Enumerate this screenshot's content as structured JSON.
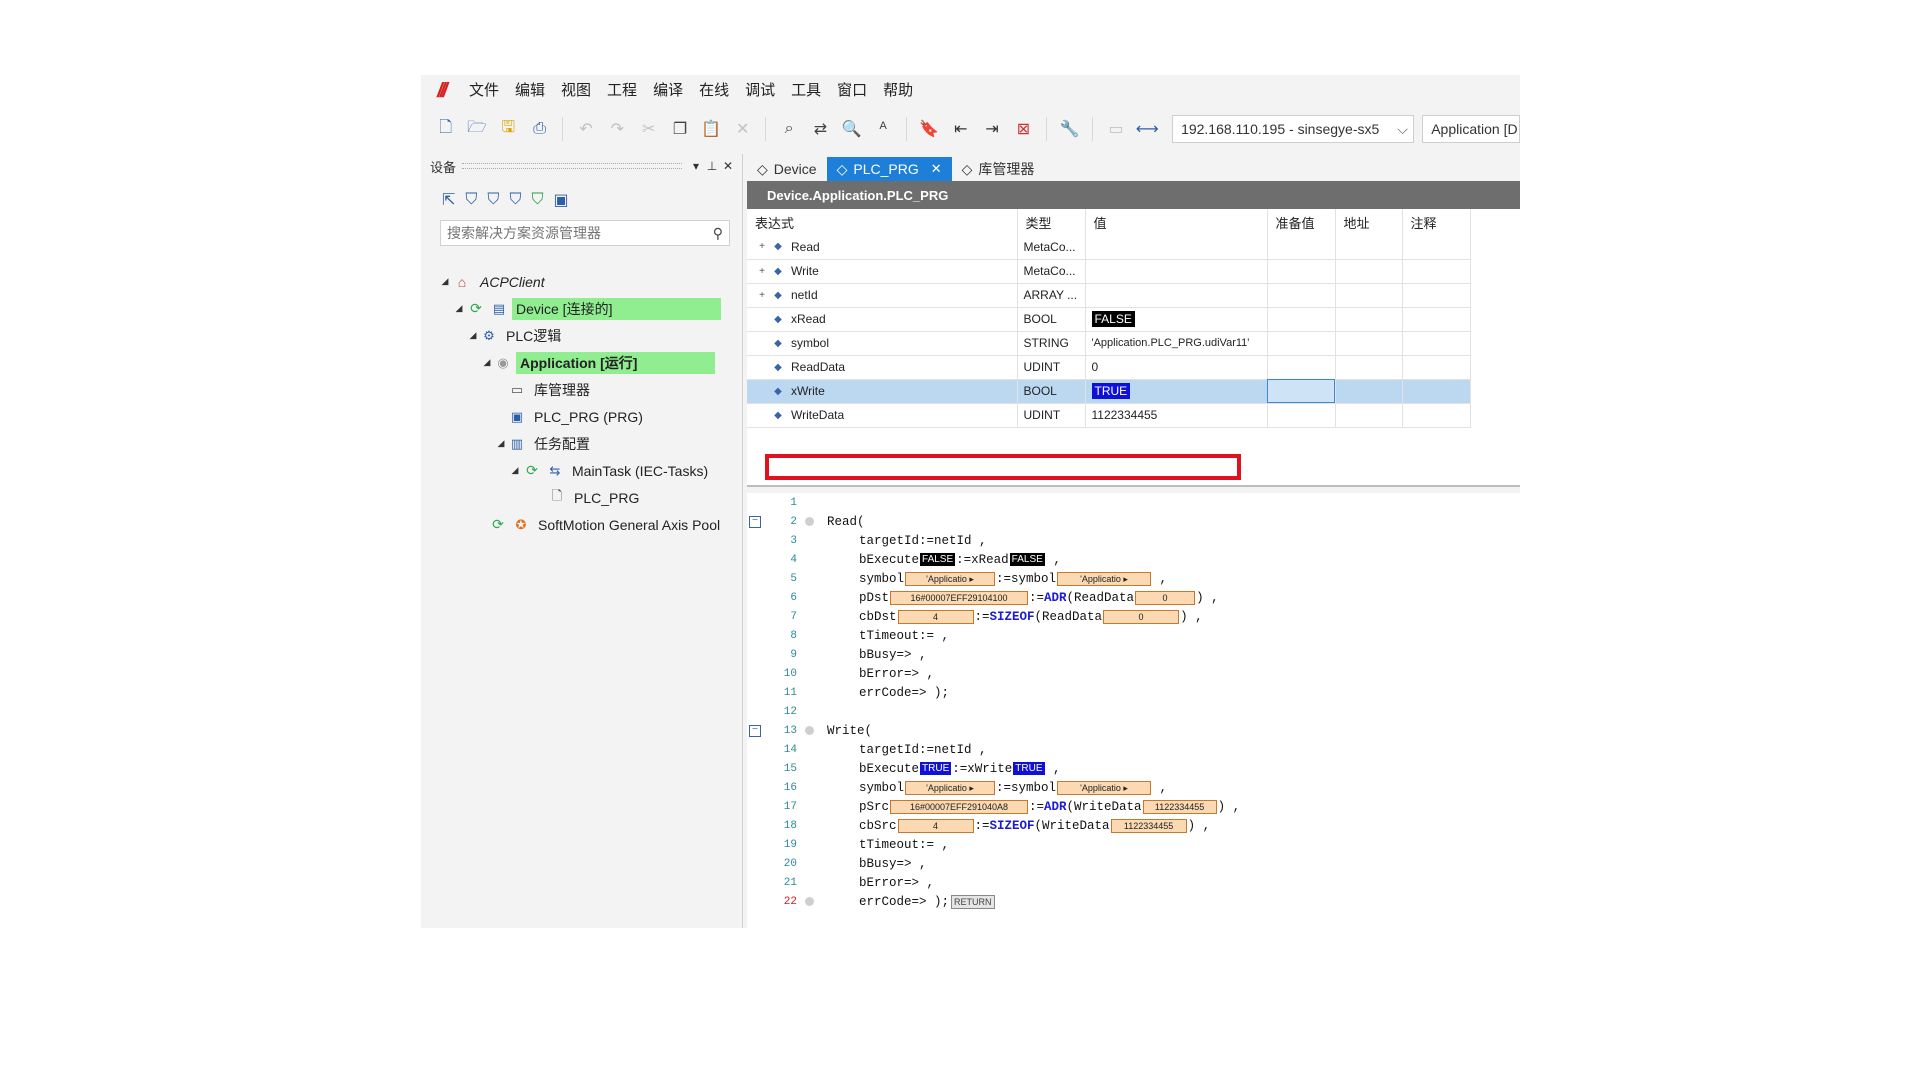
{
  "menu": {
    "logo": "///",
    "items": [
      "文件",
      "编辑",
      "视图",
      "工程",
      "编译",
      "在线",
      "调试",
      "工具",
      "窗口",
      "帮助"
    ]
  },
  "toolbar": {
    "device_combo": "192.168.110.195 - sinsegye-sx5",
    "app_combo": "Application [D",
    "combo_arrow": "⌵"
  },
  "left_panel": {
    "title": "设备",
    "search_placeholder": "搜索解决方案资源管理器",
    "tree": [
      {
        "label": "ACPClient",
        "expand": "◢"
      },
      {
        "label": "Device [连接的]",
        "expand": "◢"
      },
      {
        "label": "PLC逻辑",
        "expand": "◢"
      },
      {
        "label": "Application [运行]",
        "expand": "◢"
      },
      {
        "label": "库管理器"
      },
      {
        "label": "PLC_PRG (PRG)"
      },
      {
        "label": "任务配置",
        "expand": "◢"
      },
      {
        "label": "MainTask (IEC-Tasks)",
        "expand": "◢"
      },
      {
        "label": "PLC_PRG"
      },
      {
        "label": "SoftMotion General Axis Pool"
      }
    ]
  },
  "tabs": [
    {
      "label": "Device"
    },
    {
      "label": "PLC_PRG",
      "close": "✕"
    },
    {
      "label": "库管理器"
    }
  ],
  "doc_title": "Device.Application.PLC_PRG",
  "watch": {
    "columns": [
      "表达式",
      "类型",
      "值",
      "准备值",
      "地址",
      "注释"
    ],
    "rows": [
      {
        "expr": "Read",
        "type": "MetaCo...",
        "value": "",
        "expandable": "+"
      },
      {
        "expr": "Write",
        "type": "MetaCo...",
        "value": "",
        "expandable": "+"
      },
      {
        "expr": "netId",
        "type": "ARRAY ...",
        "value": "",
        "expandable": "+"
      },
      {
        "expr": "xRead",
        "type": "BOOL",
        "value": "FALSE"
      },
      {
        "expr": "symbol",
        "type": "STRING",
        "value": "'Application.PLC_PRG.udiVar11'"
      },
      {
        "expr": "ReadData",
        "type": "UDINT",
        "value": "0"
      },
      {
        "expr": "xWrite",
        "type": "BOOL",
        "value": "TRUE"
      },
      {
        "expr": "WriteData",
        "type": "UDINT",
        "value": "1122334455"
      }
    ]
  },
  "code": {
    "line_numbers": [
      "1",
      "2",
      "3",
      "4",
      "5",
      "6",
      "7",
      "8",
      "9",
      "10",
      "11",
      "12",
      "13",
      "14",
      "15",
      "16",
      "17",
      "18",
      "19",
      "20",
      "21",
      "22"
    ],
    "read_call": "Read(",
    "write_call": "Write(",
    "target": "targetId:=netId ,",
    "bexecute": "bExecute",
    "xread_assign": ":=xRead",
    "xwrite_assign": ":=xWrite",
    "symbol": "symbol",
    "symbol_assign": ":=symbol",
    "pdst": "pDst",
    "psrc": "pSrc",
    "adr_read_open": "(ReadData",
    "adr_write_open": "(WriteData",
    "cbdst": "cbDst",
    "cbsrc": "cbSrc",
    "sizeof_read_open": "(ReadData",
    "sizeof_write_open": "(WriteData",
    "assign": ":=",
    "adr": "ADR",
    "sizeof": "SIZEOF",
    "close_comma": ") ,",
    "comma": " ,",
    "ttimeout": "tTimeout:= ,",
    "bbusy": "bBusy=> ,",
    "berror": "bError=> ,",
    "errcode_end": "errCode=> );",
    "inline": {
      "false": "FALSE",
      "true": "TRUE",
      "applicatio": "'Applicatio",
      "tri": "▸",
      "pdst_val": "16#00007EFF29104100",
      "psrc_val": "16#00007EFF291040A8",
      "zero": "0",
      "four": "4",
      "write_val": "1122334455",
      "return": "RETURN"
    }
  }
}
